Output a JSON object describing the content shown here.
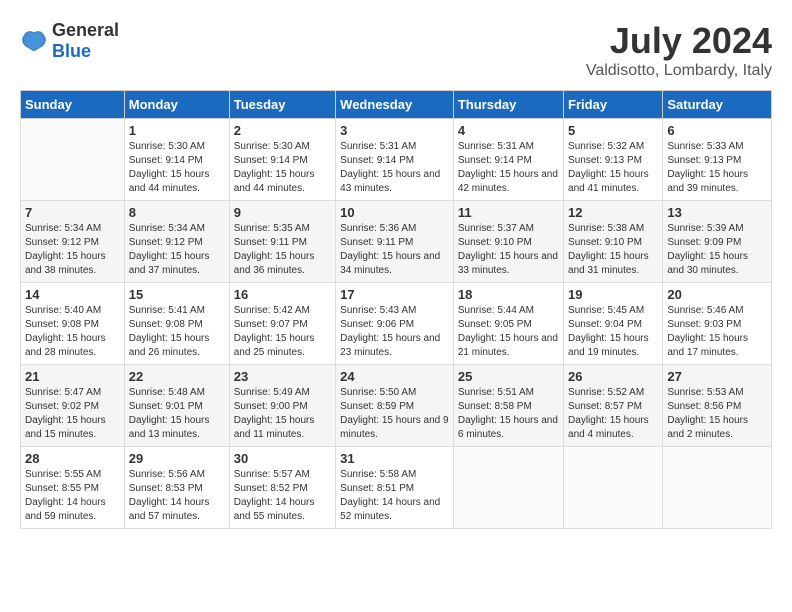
{
  "logo": {
    "general": "General",
    "blue": "Blue"
  },
  "title": "July 2024",
  "subtitle": "Valdisotto, Lombardy, Italy",
  "headers": [
    "Sunday",
    "Monday",
    "Tuesday",
    "Wednesday",
    "Thursday",
    "Friday",
    "Saturday"
  ],
  "weeks": [
    [
      {
        "date": "",
        "sunrise": "",
        "sunset": "",
        "daylight": ""
      },
      {
        "date": "1",
        "sunrise": "Sunrise: 5:30 AM",
        "sunset": "Sunset: 9:14 PM",
        "daylight": "Daylight: 15 hours and 44 minutes."
      },
      {
        "date": "2",
        "sunrise": "Sunrise: 5:30 AM",
        "sunset": "Sunset: 9:14 PM",
        "daylight": "Daylight: 15 hours and 44 minutes."
      },
      {
        "date": "3",
        "sunrise": "Sunrise: 5:31 AM",
        "sunset": "Sunset: 9:14 PM",
        "daylight": "Daylight: 15 hours and 43 minutes."
      },
      {
        "date": "4",
        "sunrise": "Sunrise: 5:31 AM",
        "sunset": "Sunset: 9:14 PM",
        "daylight": "Daylight: 15 hours and 42 minutes."
      },
      {
        "date": "5",
        "sunrise": "Sunrise: 5:32 AM",
        "sunset": "Sunset: 9:13 PM",
        "daylight": "Daylight: 15 hours and 41 minutes."
      },
      {
        "date": "6",
        "sunrise": "Sunrise: 5:33 AM",
        "sunset": "Sunset: 9:13 PM",
        "daylight": "Daylight: 15 hours and 39 minutes."
      }
    ],
    [
      {
        "date": "7",
        "sunrise": "Sunrise: 5:34 AM",
        "sunset": "Sunset: 9:12 PM",
        "daylight": "Daylight: 15 hours and 38 minutes."
      },
      {
        "date": "8",
        "sunrise": "Sunrise: 5:34 AM",
        "sunset": "Sunset: 9:12 PM",
        "daylight": "Daylight: 15 hours and 37 minutes."
      },
      {
        "date": "9",
        "sunrise": "Sunrise: 5:35 AM",
        "sunset": "Sunset: 9:11 PM",
        "daylight": "Daylight: 15 hours and 36 minutes."
      },
      {
        "date": "10",
        "sunrise": "Sunrise: 5:36 AM",
        "sunset": "Sunset: 9:11 PM",
        "daylight": "Daylight: 15 hours and 34 minutes."
      },
      {
        "date": "11",
        "sunrise": "Sunrise: 5:37 AM",
        "sunset": "Sunset: 9:10 PM",
        "daylight": "Daylight: 15 hours and 33 minutes."
      },
      {
        "date": "12",
        "sunrise": "Sunrise: 5:38 AM",
        "sunset": "Sunset: 9:10 PM",
        "daylight": "Daylight: 15 hours and 31 minutes."
      },
      {
        "date": "13",
        "sunrise": "Sunrise: 5:39 AM",
        "sunset": "Sunset: 9:09 PM",
        "daylight": "Daylight: 15 hours and 30 minutes."
      }
    ],
    [
      {
        "date": "14",
        "sunrise": "Sunrise: 5:40 AM",
        "sunset": "Sunset: 9:08 PM",
        "daylight": "Daylight: 15 hours and 28 minutes."
      },
      {
        "date": "15",
        "sunrise": "Sunrise: 5:41 AM",
        "sunset": "Sunset: 9:08 PM",
        "daylight": "Daylight: 15 hours and 26 minutes."
      },
      {
        "date": "16",
        "sunrise": "Sunrise: 5:42 AM",
        "sunset": "Sunset: 9:07 PM",
        "daylight": "Daylight: 15 hours and 25 minutes."
      },
      {
        "date": "17",
        "sunrise": "Sunrise: 5:43 AM",
        "sunset": "Sunset: 9:06 PM",
        "daylight": "Daylight: 15 hours and 23 minutes."
      },
      {
        "date": "18",
        "sunrise": "Sunrise: 5:44 AM",
        "sunset": "Sunset: 9:05 PM",
        "daylight": "Daylight: 15 hours and 21 minutes."
      },
      {
        "date": "19",
        "sunrise": "Sunrise: 5:45 AM",
        "sunset": "Sunset: 9:04 PM",
        "daylight": "Daylight: 15 hours and 19 minutes."
      },
      {
        "date": "20",
        "sunrise": "Sunrise: 5:46 AM",
        "sunset": "Sunset: 9:03 PM",
        "daylight": "Daylight: 15 hours and 17 minutes."
      }
    ],
    [
      {
        "date": "21",
        "sunrise": "Sunrise: 5:47 AM",
        "sunset": "Sunset: 9:02 PM",
        "daylight": "Daylight: 15 hours and 15 minutes."
      },
      {
        "date": "22",
        "sunrise": "Sunrise: 5:48 AM",
        "sunset": "Sunset: 9:01 PM",
        "daylight": "Daylight: 15 hours and 13 minutes."
      },
      {
        "date": "23",
        "sunrise": "Sunrise: 5:49 AM",
        "sunset": "Sunset: 9:00 PM",
        "daylight": "Daylight: 15 hours and 11 minutes."
      },
      {
        "date": "24",
        "sunrise": "Sunrise: 5:50 AM",
        "sunset": "Sunset: 8:59 PM",
        "daylight": "Daylight: 15 hours and 9 minutes."
      },
      {
        "date": "25",
        "sunrise": "Sunrise: 5:51 AM",
        "sunset": "Sunset: 8:58 PM",
        "daylight": "Daylight: 15 hours and 6 minutes."
      },
      {
        "date": "26",
        "sunrise": "Sunrise: 5:52 AM",
        "sunset": "Sunset: 8:57 PM",
        "daylight": "Daylight: 15 hours and 4 minutes."
      },
      {
        "date": "27",
        "sunrise": "Sunrise: 5:53 AM",
        "sunset": "Sunset: 8:56 PM",
        "daylight": "Daylight: 15 hours and 2 minutes."
      }
    ],
    [
      {
        "date": "28",
        "sunrise": "Sunrise: 5:55 AM",
        "sunset": "Sunset: 8:55 PM",
        "daylight": "Daylight: 14 hours and 59 minutes."
      },
      {
        "date": "29",
        "sunrise": "Sunrise: 5:56 AM",
        "sunset": "Sunset: 8:53 PM",
        "daylight": "Daylight: 14 hours and 57 minutes."
      },
      {
        "date": "30",
        "sunrise": "Sunrise: 5:57 AM",
        "sunset": "Sunset: 8:52 PM",
        "daylight": "Daylight: 14 hours and 55 minutes."
      },
      {
        "date": "31",
        "sunrise": "Sunrise: 5:58 AM",
        "sunset": "Sunset: 8:51 PM",
        "daylight": "Daylight: 14 hours and 52 minutes."
      },
      {
        "date": "",
        "sunrise": "",
        "sunset": "",
        "daylight": ""
      },
      {
        "date": "",
        "sunrise": "",
        "sunset": "",
        "daylight": ""
      },
      {
        "date": "",
        "sunrise": "",
        "sunset": "",
        "daylight": ""
      }
    ]
  ]
}
